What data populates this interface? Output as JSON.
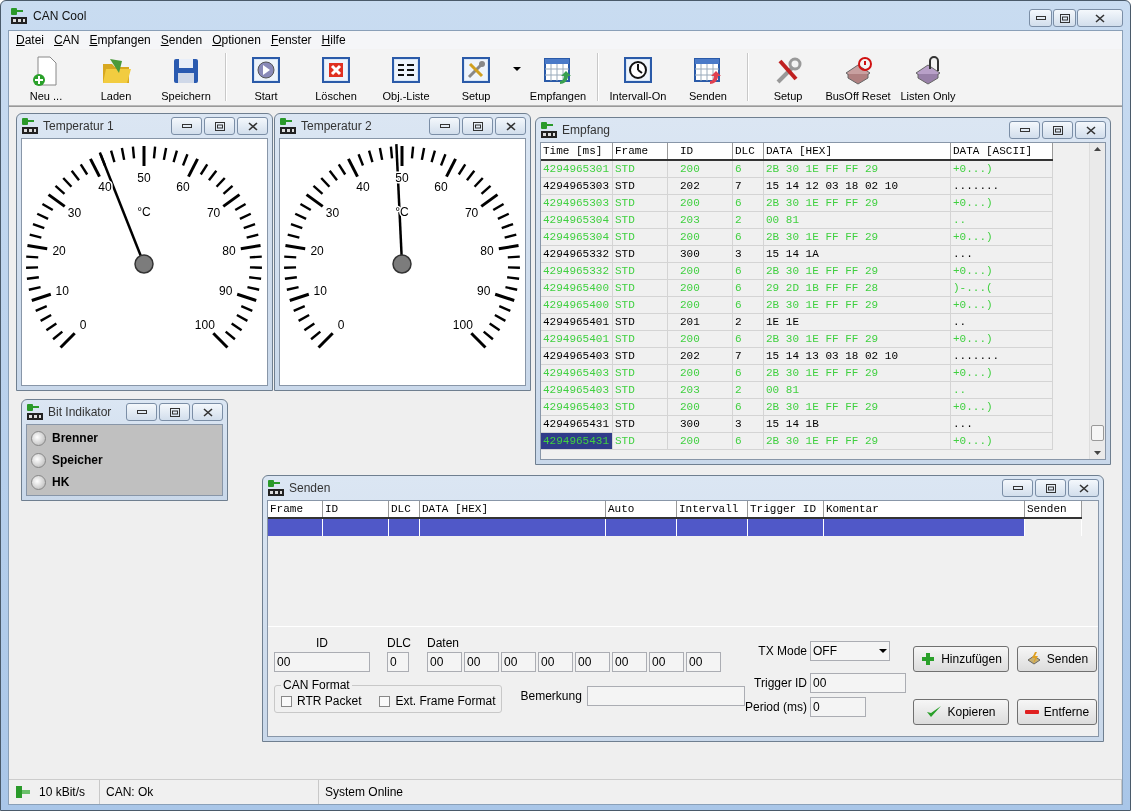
{
  "window": {
    "title": "CAN Cool"
  },
  "menu": [
    "Datei",
    "CAN",
    "Empfangen",
    "Senden",
    "Optionen",
    "Fenster",
    "Hilfe"
  ],
  "toolbar": [
    {
      "kind": "button",
      "label": "Neu ..."
    },
    {
      "kind": "button",
      "label": "Laden"
    },
    {
      "kind": "button",
      "label": "Speichern"
    },
    {
      "kind": "separator"
    },
    {
      "kind": "button",
      "label": "Start"
    },
    {
      "kind": "button",
      "label": "Löschen"
    },
    {
      "kind": "button",
      "label": "Obj.-Liste"
    },
    {
      "kind": "button",
      "label": "Setup"
    },
    {
      "kind": "dropdown"
    },
    {
      "kind": "button",
      "label": "Empfangen"
    },
    {
      "kind": "separator"
    },
    {
      "kind": "button",
      "label": "Intervall-On"
    },
    {
      "kind": "button",
      "label": "Senden"
    },
    {
      "kind": "separator"
    },
    {
      "kind": "button",
      "label": "Setup"
    },
    {
      "kind": "button",
      "label": "BusOff Reset"
    },
    {
      "kind": "button",
      "label": "Listen Only"
    }
  ],
  "gauges": [
    {
      "title": "Temperatur 1",
      "unit": "°C",
      "scale_labels": [
        "0",
        "10",
        "20",
        "30",
        "40",
        "50",
        "60",
        "70",
        "80",
        "90",
        "100"
      ]
    },
    {
      "title": "Temperatur 2",
      "unit": "°C",
      "scale_labels": [
        "0",
        "10",
        "20",
        "30",
        "40",
        "50",
        "60",
        "70",
        "80",
        "90",
        "100"
      ]
    }
  ],
  "empfang": {
    "title": "Empfang",
    "columns": [
      "Time [ms]",
      "Frame",
      "ID",
      "DLC",
      "DATA [HEX]",
      "DATA [ASCII]"
    ],
    "rows": [
      {
        "time": "4294965301",
        "frame": "STD",
        "id": "200",
        "dlc": "6",
        "data_hex": "2B 30 1E FF FF 29",
        "data_ascii": "+0...)",
        "color": "#40d040",
        "selected": false
      },
      {
        "time": "4294965303",
        "frame": "STD",
        "id": "202",
        "dlc": "7",
        "data_hex": "15 14 12 03 18 02 10",
        "data_ascii": ".......",
        "color": "#000000",
        "selected": false
      },
      {
        "time": "4294965303",
        "frame": "STD",
        "id": "200",
        "dlc": "6",
        "data_hex": "2B 30 1E FF FF 29",
        "data_ascii": "+0...)",
        "color": "#40d040",
        "selected": false
      },
      {
        "time": "4294965304",
        "frame": "STD",
        "id": "203",
        "dlc": "2",
        "data_hex": "00 81",
        "data_ascii": "..",
        "color": "#40d040",
        "selected": false
      },
      {
        "time": "4294965304",
        "frame": "STD",
        "id": "200",
        "dlc": "6",
        "data_hex": "2B 30 1E FF FF 29",
        "data_ascii": "+0...)",
        "color": "#40d040",
        "selected": false
      },
      {
        "time": "4294965332",
        "frame": "STD",
        "id": "300",
        "dlc": "3",
        "data_hex": "15 14 1A",
        "data_ascii": "...",
        "color": "#000000",
        "selected": false
      },
      {
        "time": "4294965332",
        "frame": "STD",
        "id": "200",
        "dlc": "6",
        "data_hex": "2B 30 1E FF FF 29",
        "data_ascii": "+0...)",
        "color": "#40d040",
        "selected": false
      },
      {
        "time": "4294965400",
        "frame": "STD",
        "id": "200",
        "dlc": "6",
        "data_hex": "29 2D 1B FF FF 28",
        "data_ascii": ")-...(",
        "color": "#40d040",
        "selected": false
      },
      {
        "time": "4294965400",
        "frame": "STD",
        "id": "200",
        "dlc": "6",
        "data_hex": "2B 30 1E FF FF 29",
        "data_ascii": "+0...)",
        "color": "#40d040",
        "selected": false
      },
      {
        "time": "4294965401",
        "frame": "STD",
        "id": "201",
        "dlc": "2",
        "data_hex": "1E 1E",
        "data_ascii": "..",
        "color": "#000000",
        "selected": false
      },
      {
        "time": "4294965401",
        "frame": "STD",
        "id": "200",
        "dlc": "6",
        "data_hex": "2B 30 1E FF FF 29",
        "data_ascii": "+0...)",
        "color": "#40d040",
        "selected": false
      },
      {
        "time": "4294965403",
        "frame": "STD",
        "id": "202",
        "dlc": "7",
        "data_hex": "15 14 13 03 18 02 10",
        "data_ascii": ".......",
        "color": "#000000",
        "selected": false
      },
      {
        "time": "4294965403",
        "frame": "STD",
        "id": "200",
        "dlc": "6",
        "data_hex": "2B 30 1E FF FF 29",
        "data_ascii": "+0...)",
        "color": "#40d040",
        "selected": false
      },
      {
        "time": "4294965403",
        "frame": "STD",
        "id": "203",
        "dlc": "2",
        "data_hex": "00 81",
        "data_ascii": "..",
        "color": "#40d040",
        "selected": false
      },
      {
        "time": "4294965403",
        "frame": "STD",
        "id": "200",
        "dlc": "6",
        "data_hex": "2B 30 1E FF FF 29",
        "data_ascii": "+0...)",
        "color": "#40d040",
        "selected": false
      },
      {
        "time": "4294965431",
        "frame": "STD",
        "id": "300",
        "dlc": "3",
        "data_hex": "15 14 1B",
        "data_ascii": "...",
        "color": "#000000",
        "selected": false
      },
      {
        "time": "4294965431",
        "frame": "STD",
        "id": "200",
        "dlc": "6",
        "data_hex": "2B 30 1E FF FF 29",
        "data_ascii": "+0...)",
        "color": "#40d040",
        "selected": true
      }
    ]
  },
  "bit_indikator": {
    "title": "Bit Indikator",
    "lamps": [
      {
        "label": "Brenner",
        "on": false
      },
      {
        "label": "Speicher",
        "on": false
      },
      {
        "label": "HK",
        "on": false
      }
    ]
  },
  "senden": {
    "title": "Senden",
    "columns": [
      "Frame",
      "ID",
      "DLC",
      "DATA [HEX]",
      "Auto",
      "Intervall",
      "Trigger ID",
      "Komentar",
      "Senden"
    ],
    "rows": [
      {
        "selected": true
      }
    ],
    "form": {
      "id": {
        "label": "ID",
        "value": "00"
      },
      "dlc": {
        "label": "DLC",
        "value": "0"
      },
      "data": {
        "label": "Daten",
        "values": [
          "00",
          "00",
          "00",
          "00",
          "00",
          "00",
          "00",
          "00"
        ]
      },
      "can_format": {
        "title": "CAN Format",
        "options": [
          {
            "label": "RTR Packet",
            "checked": false
          },
          {
            "label": "Ext. Frame Format",
            "checked": false
          }
        ]
      },
      "remark": {
        "label": "Bemerkung"
      },
      "tx_mode": {
        "label": "TX Mode",
        "value": "OFF"
      },
      "trigger_id": {
        "label": "Trigger ID",
        "value": "00"
      },
      "period": {
        "label": "Period (ms)",
        "value": "0"
      },
      "buttons": [
        "Hinzufügen",
        "Senden",
        "Kopieren",
        "Entferne"
      ]
    }
  },
  "status_bar": [
    "10 kBit/s",
    "CAN: Ok",
    "System Online"
  ]
}
